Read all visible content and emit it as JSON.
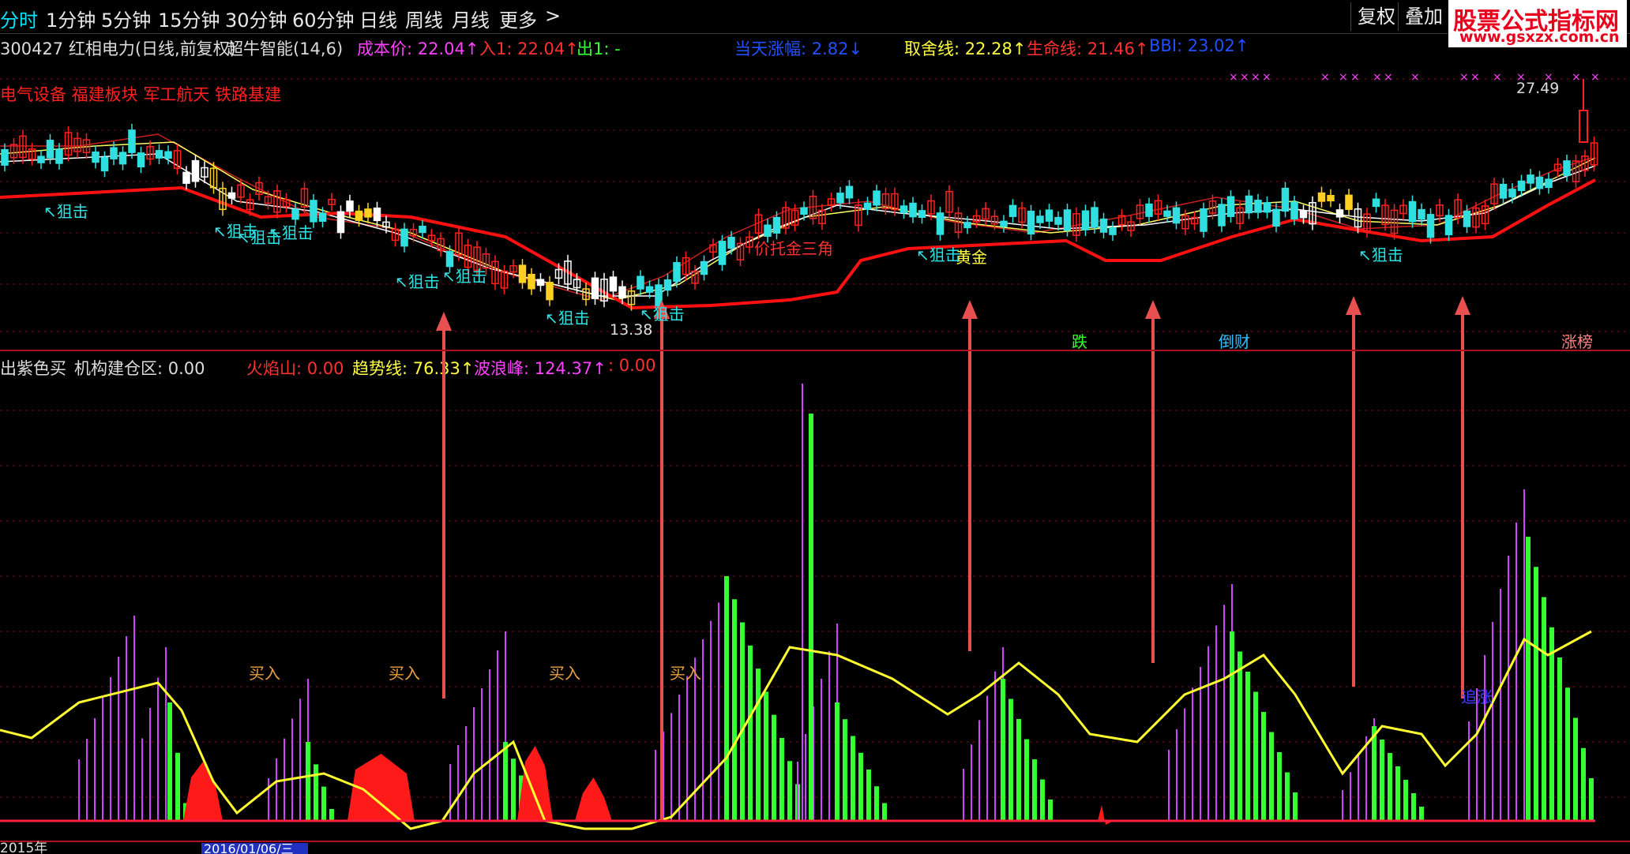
{
  "toolbar": {
    "tabs": [
      "分时",
      "1分钟",
      "5分钟",
      "15分钟",
      "30分钟",
      "60分钟",
      "日线",
      "周线",
      "月线",
      "更多"
    ],
    "more_arrow": ">",
    "right_buttons": [
      "复权",
      "叠加"
    ]
  },
  "watermark": {
    "title": "股票公式指标网",
    "url": "www.gsxzx.com.cn"
  },
  "main_chart": {
    "stock": "300427 红相电力(日线,前复权)",
    "indicator_name": "超牛智能(14,6)",
    "cost_price": "成本价: 22.04↑",
    "entry": "入1: 22.04↑",
    "exit": "出1: -",
    "today_change": "当天涨幅: 2.82↓",
    "choice_line": "取舍线: 22.28↑",
    "life_line": "生命线: 21.46↑",
    "bbi": "BBI: 23.02↑",
    "sectors": "电气设备 福建板块 军工航天 铁路基建",
    "max_price": "27.49",
    "min_price": "13.38",
    "signal_labels": [
      "狙击",
      "狙击",
      "狙击",
      "狙击",
      "狙击",
      "狙击",
      "狙击",
      "狙击",
      "狙击",
      "狙击"
    ],
    "golden": "黄金",
    "golden_triangle": "价托金三角",
    "tags": [
      "跌",
      "倒财",
      "涨榜"
    ]
  },
  "sub_chart": {
    "name": "出紫色买",
    "institution": "机构建仓区: 0.00",
    "fire_mountain": "火焰山: 0.00",
    "trend_line": "趋势线: 76.33↑",
    "wave_peak": "波浪峰: 124.37↑",
    "extra": ": 0.00",
    "buy_labels": [
      "买入",
      "买入",
      "买入",
      "买入"
    ],
    "chase": "追涨"
  },
  "date_axis": {
    "start": "2015年",
    "selected_date": "2016/01/06/三"
  },
  "colors": {
    "up": "#ff2020",
    "down": "#30e0e0",
    "life_line": "#ff1010",
    "trend": "#ffff30",
    "green_bar": "#33ff33",
    "purple_bar": "#cc44ff",
    "arrow": "#e85050"
  },
  "chart_data": {
    "type": "candlestick",
    "price_range": [
      13.38,
      27.49
    ],
    "annotations": [
      "27.49",
      "13.38"
    ]
  }
}
